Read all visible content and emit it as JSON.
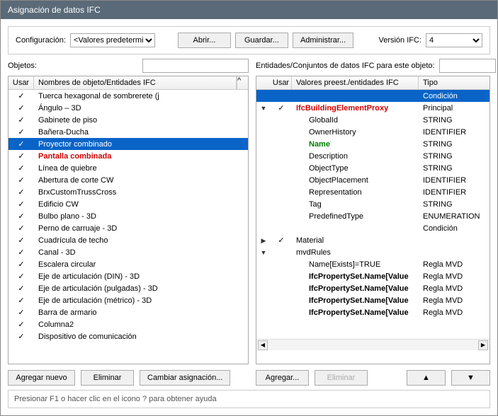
{
  "window": {
    "title": "Asignación de datos IFC"
  },
  "config": {
    "label": "Configuración:",
    "dropdown": "<Valores predetermi",
    "open": "Abrir...",
    "save": "Guardar...",
    "admin": "Administrar...",
    "version_label": "Versión IFC:",
    "version": "4"
  },
  "left": {
    "header": "Objetos:",
    "filter": "",
    "col_use": "Usar",
    "col_name": "Nombres de objeto/Entidades IFC",
    "rows": [
      {
        "use": true,
        "name": "Tuerca hexagonal de sombrerete (j",
        "cls": ""
      },
      {
        "use": true,
        "name": "Ángulo – 3D",
        "cls": ""
      },
      {
        "use": true,
        "name": "Gabinete de piso",
        "cls": ""
      },
      {
        "use": true,
        "name": "Bañera-Ducha",
        "cls": ""
      },
      {
        "use": true,
        "name": "Proyector combinado",
        "cls": "selected"
      },
      {
        "use": true,
        "name": "Pantalla combinada",
        "cls": "red"
      },
      {
        "use": true,
        "name": "Línea de quiebre",
        "cls": ""
      },
      {
        "use": true,
        "name": "Abertura de corte CW",
        "cls": ""
      },
      {
        "use": true,
        "name": "BrxCustomTrussCross",
        "cls": ""
      },
      {
        "use": true,
        "name": "Edificio CW",
        "cls": ""
      },
      {
        "use": true,
        "name": "Bulbo plano - 3D",
        "cls": ""
      },
      {
        "use": true,
        "name": "Perno de carruaje - 3D",
        "cls": ""
      },
      {
        "use": true,
        "name": "Cuadrícula de techo",
        "cls": ""
      },
      {
        "use": true,
        "name": "Canal - 3D",
        "cls": ""
      },
      {
        "use": true,
        "name": "Escalera circular",
        "cls": ""
      },
      {
        "use": true,
        "name": "Eje de articulación (DIN) - 3D",
        "cls": ""
      },
      {
        "use": true,
        "name": "Eje de articulación (pulgadas) - 3D",
        "cls": ""
      },
      {
        "use": true,
        "name": "Eje de articulación (métrico) - 3D",
        "cls": ""
      },
      {
        "use": true,
        "name": "Barra de armario",
        "cls": ""
      },
      {
        "use": true,
        "name": "Columna2",
        "cls": ""
      },
      {
        "use": true,
        "name": "Dispositivo de comunicación",
        "cls": ""
      }
    ],
    "btn_add": "Agregar nuevo",
    "btn_del": "Eliminar",
    "btn_change": "Cambiar asignación..."
  },
  "right": {
    "header": "Entidades/Conjuntos de datos IFC para este objeto:",
    "filter": "",
    "col_use": "Usar",
    "col_name": "Valores preest./entidades IFC",
    "col_type": "Tipo",
    "rows": [
      {
        "arrow": "",
        "use": "",
        "name": "",
        "type": "Condición",
        "cls": "selected",
        "indent": 0
      },
      {
        "arrow": "▼",
        "use": "✓",
        "name": "IfcBuildingElementProxy",
        "type": "Principal",
        "cls": "red",
        "indent": 0
      },
      {
        "arrow": "",
        "use": "",
        "name": "GlobalId",
        "type": "STRING",
        "cls": "",
        "indent": 1
      },
      {
        "arrow": "",
        "use": "",
        "name": "OwnerHistory",
        "type": "IDENTIFIER",
        "cls": "",
        "indent": 1
      },
      {
        "arrow": "",
        "use": "",
        "name": "Name",
        "type": "STRING",
        "cls": "green",
        "indent": 1
      },
      {
        "arrow": "",
        "use": "",
        "name": "Description",
        "type": "STRING",
        "cls": "",
        "indent": 1
      },
      {
        "arrow": "",
        "use": "",
        "name": "ObjectType",
        "type": "STRING",
        "cls": "",
        "indent": 1
      },
      {
        "arrow": "",
        "use": "",
        "name": "ObjectPlacement",
        "type": "IDENTIFIER",
        "cls": "",
        "indent": 1
      },
      {
        "arrow": "",
        "use": "",
        "name": "Representation",
        "type": "IDENTIFIER",
        "cls": "",
        "indent": 1
      },
      {
        "arrow": "",
        "use": "",
        "name": "Tag",
        "type": "STRING",
        "cls": "",
        "indent": 1
      },
      {
        "arrow": "",
        "use": "",
        "name": "PredefinedType",
        "type": "ENUMERATION",
        "cls": "",
        "indent": 1
      },
      {
        "arrow": "",
        "use": "",
        "name": "",
        "type": "Condición",
        "cls": "",
        "indent": 0
      },
      {
        "arrow": "▶",
        "use": "✓",
        "name": "Material",
        "type": "",
        "cls": "",
        "indent": 0
      },
      {
        "arrow": "▼",
        "use": "",
        "name": "mvdRules",
        "type": "",
        "cls": "",
        "indent": 0
      },
      {
        "arrow": "",
        "use": "",
        "name": "Name[Exists]=TRUE",
        "type": "Regla MVD",
        "cls": "",
        "indent": 1
      },
      {
        "arrow": "",
        "use": "",
        "name": "IfcPropertySet.Name[Value",
        "type": "Regla MVD",
        "cls": "bold",
        "indent": 1
      },
      {
        "arrow": "",
        "use": "",
        "name": "IfcPropertySet.Name[Value",
        "type": "Regla MVD",
        "cls": "bold",
        "indent": 1
      },
      {
        "arrow": "",
        "use": "",
        "name": "IfcPropertySet.Name[Value",
        "type": "Regla MVD",
        "cls": "bold",
        "indent": 1
      },
      {
        "arrow": "",
        "use": "",
        "name": "IfcPropertySet.Name[Value",
        "type": "Regla MVD",
        "cls": "bold",
        "indent": 1
      }
    ],
    "btn_add": "Agregar...",
    "btn_del": "Eliminar",
    "btn_up": "▲",
    "btn_down": "▼"
  },
  "status": "Presionar F1 o hacer clic en el icono ? para obtener ayuda"
}
